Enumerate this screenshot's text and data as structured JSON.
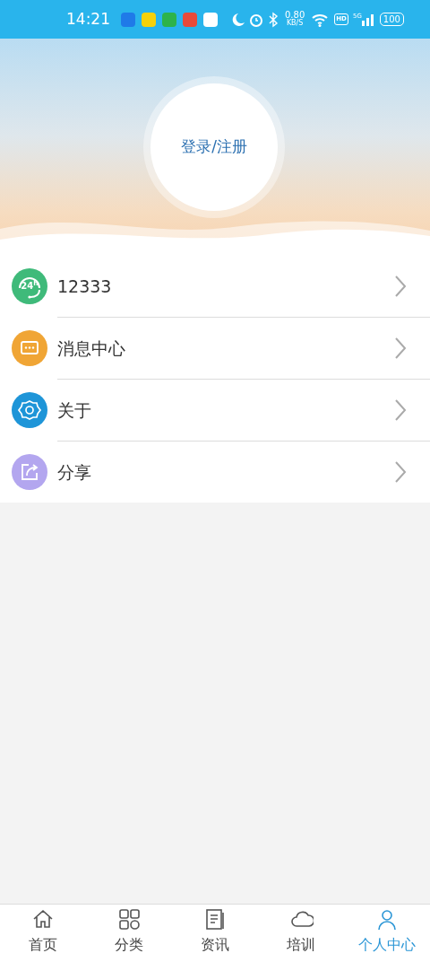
{
  "status_bar": {
    "time": "14:21",
    "speed": "0.80",
    "speed_unit": "KB/S",
    "hd": "HD",
    "network": "5G",
    "battery": "100"
  },
  "profile": {
    "login_label": "登录/注册"
  },
  "menu": [
    {
      "kind": "hotline",
      "label": "12333",
      "icon_text": "24$^{h}$"
    },
    {
      "kind": "messages",
      "label": "消息中心"
    },
    {
      "kind": "about",
      "label": "关于"
    },
    {
      "kind": "share",
      "label": "分享"
    }
  ],
  "tabs": [
    {
      "kind": "home",
      "label": "首页",
      "selected": false
    },
    {
      "kind": "category",
      "label": "分类",
      "selected": false
    },
    {
      "kind": "news",
      "label": "资讯",
      "selected": false
    },
    {
      "kind": "training",
      "label": "培训",
      "selected": false
    },
    {
      "kind": "profile",
      "label": "个人中心",
      "selected": true
    }
  ]
}
